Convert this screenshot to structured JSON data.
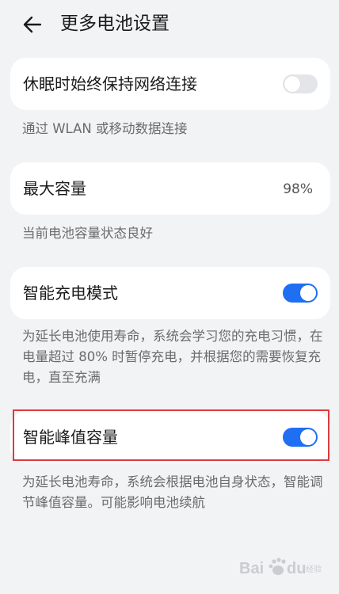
{
  "header": {
    "back_icon": "arrow-left-icon",
    "title": "更多电池设置"
  },
  "settings": [
    {
      "title": "休眠时始终保持网络连接",
      "toggle": false,
      "description": "通过 WLAN 或移动数据连接"
    },
    {
      "title": "最大容量",
      "value": "98%",
      "description": "当前电池容量状态良好"
    },
    {
      "title": "智能充电模式",
      "toggle": true,
      "description": "为延长电池使用寿命，系统会学习您的充电习惯，在电量超过 80% 时暂停充电，并根据您的需要恢复充电，直至充满"
    },
    {
      "title": "智能峰值容量",
      "toggle": true,
      "description": "为延长电池寿命，系统会根据电池自身状态，智能调节峰值容量。可能影响电池续航"
    }
  ],
  "colors": {
    "background": "#f1f3f5",
    "card": "#ffffff",
    "toggle_on": "#1f6ff2",
    "toggle_off": "#e3e5e8",
    "highlight": "#e0393e"
  },
  "watermark": {
    "icon": "baidu-paw-logo-icon",
    "text": "Bai du 经验"
  }
}
